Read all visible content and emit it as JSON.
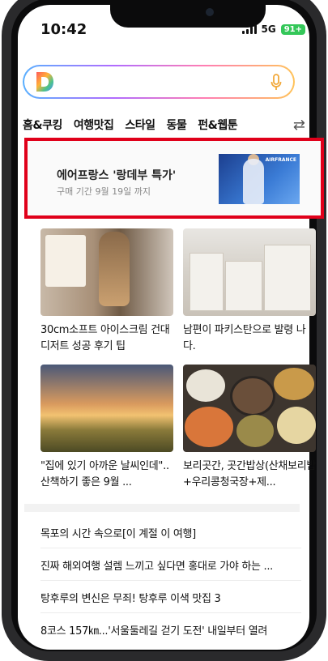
{
  "status": {
    "time": "10:42",
    "network": "5G",
    "battery": "91+"
  },
  "search": {
    "logo_letter": "D"
  },
  "tabs": [
    "홈&쿠킹",
    "여행맛집",
    "스타일",
    "동물",
    "펀&웹툰"
  ],
  "ad": {
    "title": "에어프랑스 '랑데부 특가'",
    "subtitle": "구매 기간 9월 19일 까지",
    "brand": "AIRFRANCE"
  },
  "cards": [
    {
      "caption": "30cm소프트 아이스크림 건대디저트 성공 후기 팁"
    },
    {
      "caption": "남편이 파키스탄으로 발령 나다."
    },
    {
      "caption": "\"집에 있기 아까운 날씨인데\"..산책하기 좋은 9월 ..."
    },
    {
      "caption": "보리곳간, 곳간밥상(산채보리밥+우리콩청국장+제..."
    }
  ],
  "list": [
    "목포의 시간 속으로[이 계절 이 여행]",
    "진짜 해외여행 설렘 느끼고 싶다면 홍대로 가야 하는 ...",
    "탕후루의 변신은 무죄! 탕후루 이색 맛집 3",
    "8코스 157㎞...'서울둘레길 걷기 도전' 내일부터 열려"
  ],
  "colors": {
    "highlight_border": "#e0001a",
    "battery": "#34c759"
  }
}
